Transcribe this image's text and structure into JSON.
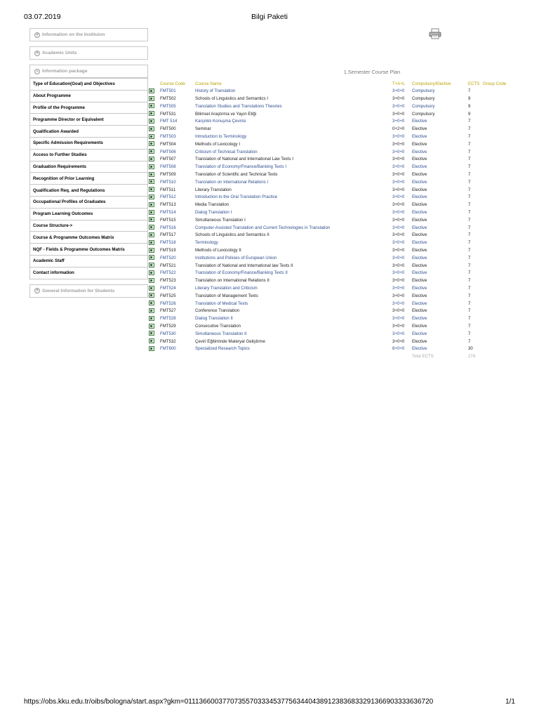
{
  "print": {
    "date": "03.07.2019",
    "title": "Bilgi Paketi",
    "url": "https://obs.kku.edu.tr/oibs/bologna/start.aspx?gkm=0111366003770735570333453775634404389123836833291366903333636720",
    "pages": "1/1"
  },
  "sidebar": {
    "sections": {
      "institution": "Information on the Instituion",
      "units": "Academic Units",
      "package": "Information package",
      "general": "General Information for Students"
    },
    "menu": [
      "Type of Education(Goal) and Objectives",
      "About Programme",
      "Profile of the Programme",
      "Programme Director or Equivalent",
      "Qualification Awarded",
      "Specific Admission Requirements",
      "Access to Further Studies",
      "Graduation Requirements",
      "Recognition of Prior Learning",
      "Qualification Req. and Regulations",
      "Occupational Profiles of Graduates",
      "Program Learning Outcomes",
      "Course Structure->",
      "Course & Programme Outcomes Matrix",
      "NQF - Fields & Programme Outcomes Matris",
      "Academic Staff",
      "Contact information"
    ],
    "icons": {
      "section_toggle": "plus-circle-icon",
      "print": "printer-icon",
      "course": "course-detail-icon"
    }
  },
  "courses": {
    "semester_title": "1.Semester Course Plan",
    "headers": {
      "code": "Course Code",
      "name": "Course Name",
      "tal": "T+A+L",
      "type": "Compulsory/Elective",
      "ects": "ECTS",
      "group": "Group Code"
    },
    "rows": [
      [
        "FMT501",
        "History of Translation",
        "3+0+0",
        "Compulsory",
        "7",
        "link"
      ],
      [
        "FMT502",
        "Schools of Linguistics and Semantics I",
        "3+0+0",
        "Compulsory",
        "9",
        "plain"
      ],
      [
        "FMT505",
        "Translation Studies and Translations Theories",
        "3+0+0",
        "Compulsory",
        "9",
        "link"
      ],
      [
        "FMT531",
        "Bilimsel Araştırma ve Yayın Etiği",
        "3+0+0",
        "Compulsory",
        "9",
        "plain"
      ],
      [
        "FMT 514",
        "Karşılıklı Konuşma Çevirisi",
        "3+0+0",
        "Elective",
        "7",
        "link"
      ],
      [
        "FMT500",
        "Seminar",
        "0+2+0",
        "Elective",
        "7",
        "plain"
      ],
      [
        "FMT503",
        "Introduction to Terminology",
        "3+0+0",
        "Elective",
        "7",
        "link"
      ],
      [
        "FMT504",
        "Methods of Lexicology I",
        "3+0+0",
        "Elective",
        "7",
        "plain"
      ],
      [
        "FMT506",
        "Criticism of Technical Translation",
        "3+0+0",
        "Elective",
        "7",
        "link"
      ],
      [
        "FMT507",
        "Translation of National and International Law Texts I",
        "3+0+0",
        "Elective",
        "7",
        "plain"
      ],
      [
        "FMT508",
        "Translation of Economy/Finance/Banking Texts I",
        "3+0+0",
        "Elective",
        "7",
        "link"
      ],
      [
        "FMT509",
        "Translation of Scientific and Technical Texts",
        "3+0+0",
        "Elective",
        "7",
        "plain"
      ],
      [
        "FMT510",
        "Translation on International Relations I",
        "3+0+0",
        "Elective",
        "7",
        "link"
      ],
      [
        "FMT511",
        "Literary Translation",
        "3+0+0",
        "Elective",
        "7",
        "plain"
      ],
      [
        "FMT512",
        "Introduction to the Oral Translation Practice",
        "3+0+0",
        "Elective",
        "7",
        "link"
      ],
      [
        "FMT513",
        "Media Translation",
        "3+0+0",
        "Elective",
        "7",
        "plain"
      ],
      [
        "FMT514",
        "Dialog Translation I",
        "3+0+0",
        "Elective",
        "7",
        "link"
      ],
      [
        "FMT515",
        "Simultaneous Translation I",
        "3+0+0",
        "Elective",
        "7",
        "plain"
      ],
      [
        "FMT516",
        "Computer-Assisted Translation and Current Technologies in Translation",
        "3+0+0",
        "Elective",
        "7",
        "link"
      ],
      [
        "FMT517",
        "Schools of Linguistics and Semantics II",
        "3+0+0",
        "Elective",
        "7",
        "plain"
      ],
      [
        "FMT518",
        "Terminology",
        "3+0+0",
        "Elective",
        "7",
        "link"
      ],
      [
        "FMT519",
        "Methods of Lexicology II",
        "3+0+0",
        "Elective",
        "7",
        "plain"
      ],
      [
        "FMT520",
        "Institutions and Policies of European Union",
        "3+0+0",
        "Elective",
        "7",
        "link"
      ],
      [
        "FMT521",
        "Translation of National and International law Texts II",
        "3+0+0",
        "Elective",
        "7",
        "plain"
      ],
      [
        "FMT522",
        "Translation of Economy/Finance/Banking Texts II",
        "3+0+0",
        "Elective",
        "7",
        "link"
      ],
      [
        "FMT523",
        "Translation on International Relations II",
        "3+0+0",
        "Elective",
        "7",
        "plain"
      ],
      [
        "FMT524",
        "Literary Translation and Criticism",
        "3+0+0",
        "Elective",
        "7",
        "link"
      ],
      [
        "FMT525",
        "Translation of Management Texts",
        "3+0+0",
        "Elective",
        "7",
        "plain"
      ],
      [
        "FMT526",
        "Translation of Medical Texts",
        "3+0+0",
        "Elective",
        "7",
        "link"
      ],
      [
        "FMT527",
        "Conference Translation",
        "3+0+0",
        "Elective",
        "7",
        "plain"
      ],
      [
        "FMT528",
        "Dialog Translation II",
        "3+0+0",
        "Elective",
        "7",
        "link"
      ],
      [
        "FMT529",
        "Consecutive Translation",
        "3+0+0",
        "Elective",
        "7",
        "plain"
      ],
      [
        "FMT530",
        "Simultaneous Translation II",
        "3+0+0",
        "Elective",
        "7",
        "link"
      ],
      [
        "FMT532",
        "Çeviri Eğitiminde Materyal Geliştirme",
        "3+0+0",
        "Elective",
        "7",
        "plain"
      ],
      [
        "FMT600",
        "Specialized Research Topics",
        "8+0+0",
        "Elective",
        "30",
        "link"
      ]
    ],
    "total_label": "Total ECTS",
    "total_value": "274"
  }
}
